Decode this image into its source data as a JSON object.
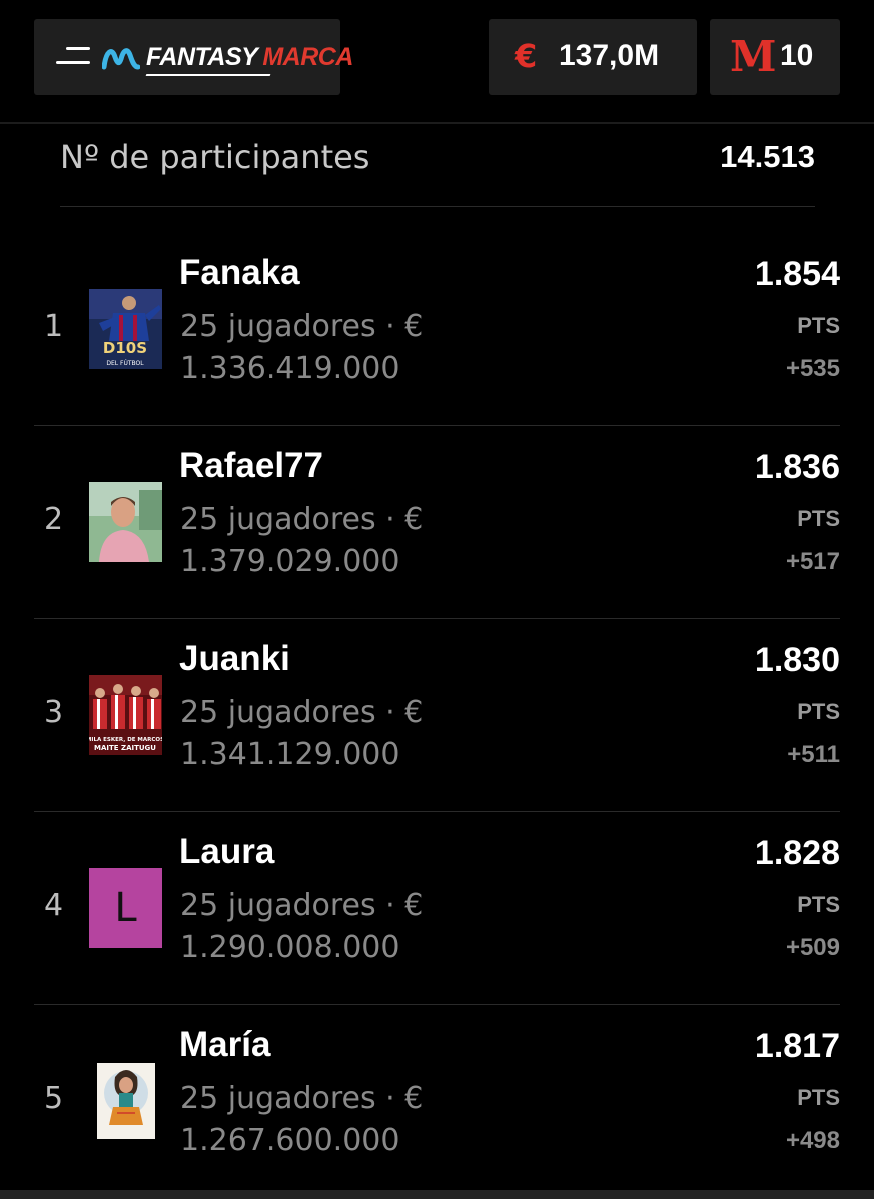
{
  "header": {
    "logo_fantasy": "FANTASY",
    "logo_marca": "MARCA",
    "budget_icon": "€",
    "budget": "137,0M",
    "marca_icon": "M",
    "marca_points": "10",
    "colors": {
      "accent": "#e0312a",
      "movistar": "#3db4e5",
      "panel": "#1f1f1f"
    }
  },
  "participants": {
    "label": "Nº de participantes",
    "value": "14.513"
  },
  "ranking": [
    {
      "rank": "1",
      "name": "Fanaka",
      "players": "25 jugadores · €",
      "value": "1.336.419.000",
      "points": "1.854",
      "pts_label": "PTS",
      "delta": "+535",
      "avatar": "photo-avatar",
      "avatar_text": "D10S"
    },
    {
      "rank": "2",
      "name": "Rafael77",
      "players": "25 jugadores · €",
      "value": "1.379.029.000",
      "points": "1.836",
      "pts_label": "PTS",
      "delta": "+517",
      "avatar": "photo-avatar"
    },
    {
      "rank": "3",
      "name": "Juanki",
      "players": "25 jugadores · €",
      "value": "1.341.129.000",
      "points": "1.830",
      "pts_label": "PTS",
      "delta": "+511",
      "avatar": "photo-avatar",
      "avatar_text": "MAITE ZAITUGU"
    },
    {
      "rank": "4",
      "name": "Laura",
      "players": "25 jugadores · €",
      "value": "1.290.008.000",
      "points": "1.828",
      "pts_label": "PTS",
      "delta": "+509",
      "avatar": "letter-avatar",
      "avatar_letter": "L",
      "avatar_color": "#b5449f"
    },
    {
      "rank": "5",
      "name": "María",
      "players": "25 jugadores · €",
      "value": "1.267.600.000",
      "points": "1.817",
      "pts_label": "PTS",
      "delta": "+498",
      "avatar": "photo-avatar"
    }
  ]
}
